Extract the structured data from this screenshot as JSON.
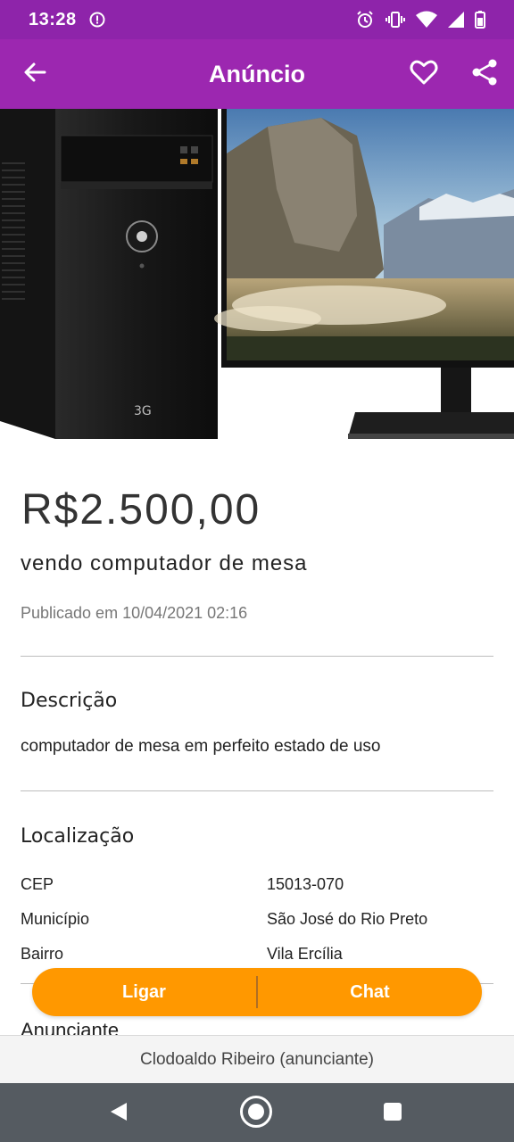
{
  "status_bar": {
    "time": "13:28",
    "icons": [
      "shield-icon",
      "alarm-icon",
      "vibrate-icon",
      "wifi-icon",
      "signal-icon",
      "battery-icon"
    ]
  },
  "app_bar": {
    "title": "Anúncio",
    "icons": [
      "back-arrow-icon",
      "heart-icon",
      "share-icon"
    ]
  },
  "ad": {
    "price": "R$2.500,00",
    "title": "vendo computador de mesa",
    "published": "Publicado em 10/04/2021 02:16"
  },
  "description": {
    "heading": "Descrição",
    "text": "computador de mesa em perfeito estado de uso"
  },
  "location": {
    "heading": "Localização",
    "rows": [
      {
        "label": "CEP",
        "value": "15013-070"
      },
      {
        "label": "Município",
        "value": "São José do Rio Preto"
      },
      {
        "label": "Bairro",
        "value": "Vila Ercília"
      }
    ]
  },
  "advertiser": {
    "heading": "Anunciante"
  },
  "actions": {
    "call_label": "Ligar",
    "chat_label": "Chat"
  },
  "footer": {
    "text": "Clodoaldo Ribeiro (anunciante)"
  },
  "colors": {
    "app_bar": "#9c27b0",
    "status_bar": "#8e24aa",
    "action_button": "#ff9800",
    "nav_bar": "#555b61"
  },
  "nav_bar": {
    "icons": [
      "nav-back-icon",
      "nav-home-icon",
      "nav-recents-icon"
    ]
  }
}
